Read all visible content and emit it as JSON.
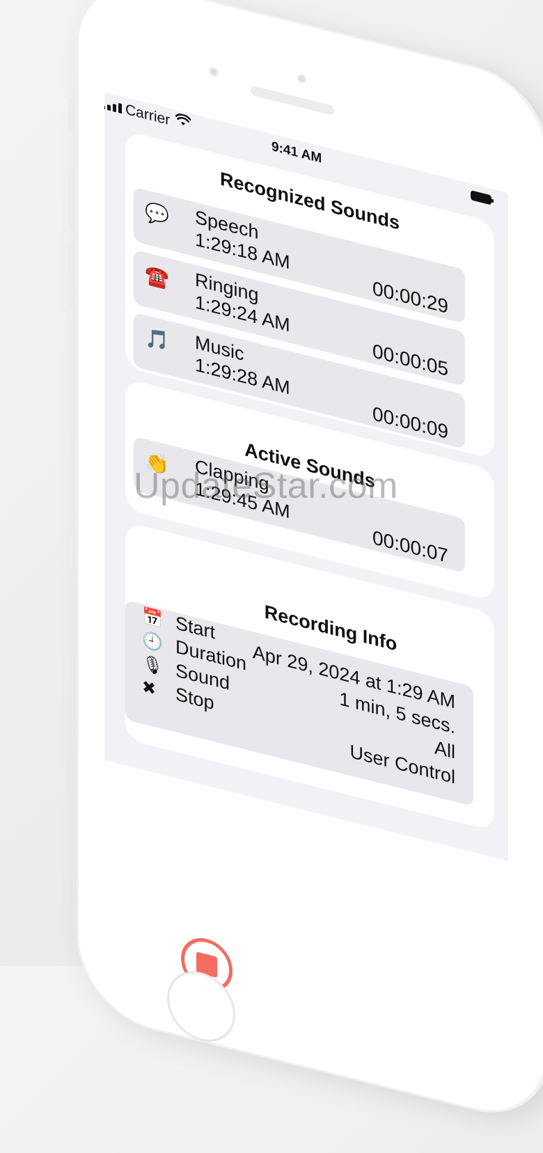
{
  "status_bar": {
    "carrier": "Carrier",
    "time": "9:41 AM"
  },
  "recognized": {
    "title": "Recognized Sounds",
    "rows": [
      {
        "icon": "speech-bubble-icon",
        "glyph": "💬",
        "name": "Speech",
        "start": "1:29:18 AM",
        "duration": "00:00:29"
      },
      {
        "icon": "telephone-icon",
        "glyph": "☎️",
        "name": "Ringing",
        "start": "1:29:24 AM",
        "duration": "00:00:05"
      },
      {
        "icon": "music-note-icon",
        "glyph": "🎵",
        "name": "Music",
        "start": "1:29:28 AM",
        "duration": "00:00:09"
      }
    ]
  },
  "active": {
    "title": "Active Sounds",
    "rows": [
      {
        "icon": "clapping-hands-icon",
        "glyph": "👏",
        "name": "Clapping",
        "start": "1:29:45 AM",
        "duration": "00:00:07"
      }
    ]
  },
  "recording_info": {
    "title": "Recording Info",
    "start_label": "Start",
    "duration_label": "Duration",
    "sound_label": "Sound",
    "stop_label": "Stop",
    "start_value": "Apr 29, 2024 at 1:29 AM",
    "duration_value": "1 min, 5 secs.",
    "sound_value": "All",
    "stop_value": "User Control"
  },
  "controls": {
    "stop_button_color": "#f46b60"
  },
  "watermark": "UpdateStar.com"
}
